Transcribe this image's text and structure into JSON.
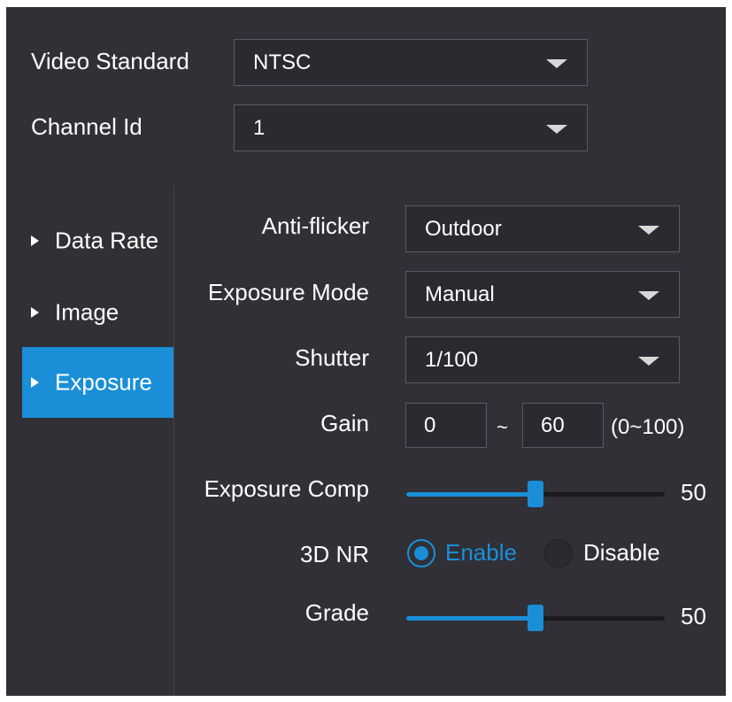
{
  "top": {
    "video_standard": {
      "label": "Video Standard",
      "value": "NTSC"
    },
    "channel_id": {
      "label": "Channel Id",
      "value": "1"
    }
  },
  "sidebar": {
    "items": [
      {
        "label": "Data Rate",
        "active": false
      },
      {
        "label": "Image",
        "active": false
      },
      {
        "label": "Exposure",
        "active": true
      }
    ]
  },
  "exposure": {
    "anti_flicker": {
      "label": "Anti-flicker",
      "value": "Outdoor"
    },
    "exposure_mode": {
      "label": "Exposure Mode",
      "value": "Manual"
    },
    "shutter": {
      "label": "Shutter",
      "value": "1/100"
    },
    "gain": {
      "label": "Gain",
      "min": "0",
      "separator": "~",
      "max": "60",
      "range_hint": "(0~100)"
    },
    "exposure_comp": {
      "label": "Exposure Comp",
      "value": "50",
      "level": 0.5
    },
    "nr3d": {
      "label": "3D NR",
      "enable_label": "Enable",
      "disable_label": "Disable",
      "selected": "Enable"
    },
    "grade": {
      "label": "Grade",
      "value": "50",
      "level": 0.5
    }
  },
  "colors": {
    "accent": "#1a8fd8",
    "panel": "#303036"
  }
}
